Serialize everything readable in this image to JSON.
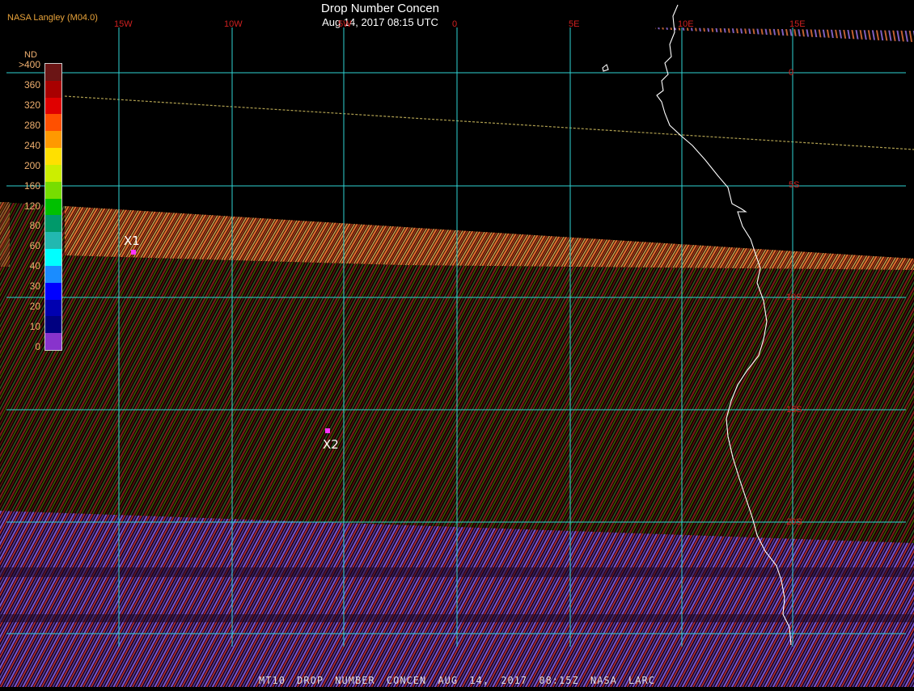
{
  "map": {
    "title": "Drop Number Concen",
    "subtitle": "Aug 14, 2017 08:15 UTC",
    "producer": "NASA Langley (M04.0)",
    "footer": "MT10  DROP NUMBER CONCEN  AUG 14, 2017 08:15Z  NASA LARC"
  },
  "grid": {
    "longitudes": [
      "15W",
      "10W",
      "5W",
      "0",
      "5E",
      "10E",
      "15E"
    ],
    "latitudes": [
      "0",
      "5S",
      "10S",
      "15S",
      "20S"
    ],
    "line_color": "#2fd4d4",
    "label_color": "#d02020"
  },
  "legend": {
    "unit": "ND",
    "labels": [
      ">400",
      "360",
      "320",
      "280",
      "240",
      "200",
      "160",
      "120",
      "80",
      "60",
      "40",
      "30",
      "20",
      "10",
      "0"
    ],
    "colors": [
      "#6b1515",
      "#a80000",
      "#e00000",
      "#ff5000",
      "#ff9900",
      "#ffe000",
      "#ccee00",
      "#77dd00",
      "#00c000",
      "#00996a",
      "#22b8b0",
      "#00ffff",
      "#1a8cff",
      "#0000ff",
      "#0000b0",
      "#000080",
      "#8833cc"
    ]
  },
  "markers": [
    {
      "label": "X1",
      "color": "#ff33ff"
    },
    {
      "label": "X2",
      "color": "#ff33ff"
    }
  ]
}
